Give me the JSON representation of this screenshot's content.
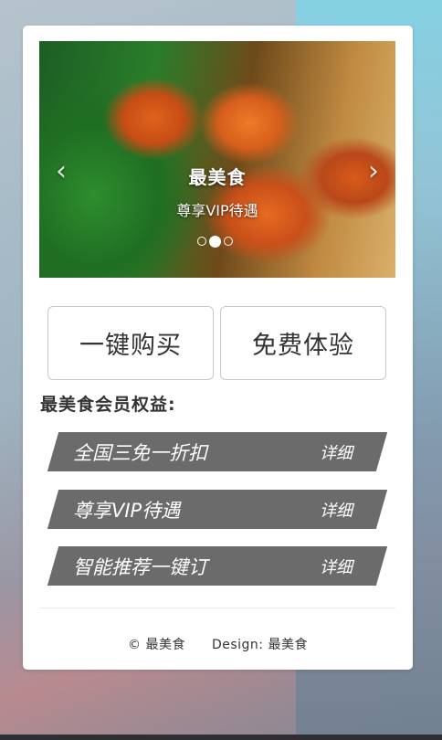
{
  "banner": {
    "title": "最美食",
    "subtitle": "尊享VIP待遇",
    "prev_icon": "chevron-left-icon",
    "next_icon": "chevron-right-icon",
    "slide_count": 3,
    "active_slide": 2
  },
  "actions": {
    "buy_label": "一键购买",
    "trial_label": "免费体验"
  },
  "benefits": {
    "title": "最美食会员权益:",
    "items": [
      {
        "label": "全国三免一折扣",
        "detail": "详细"
      },
      {
        "label": "尊享VIP待遇",
        "detail": "详细"
      },
      {
        "label": "智能推荐一键订",
        "detail": "详细"
      }
    ]
  },
  "footer": {
    "copyright": "© 最美食",
    "design": "Design: 最美食"
  },
  "colors": {
    "card_bg": "#ffffff",
    "benefit_bg": "#6b6b6b",
    "text": "#333333"
  }
}
